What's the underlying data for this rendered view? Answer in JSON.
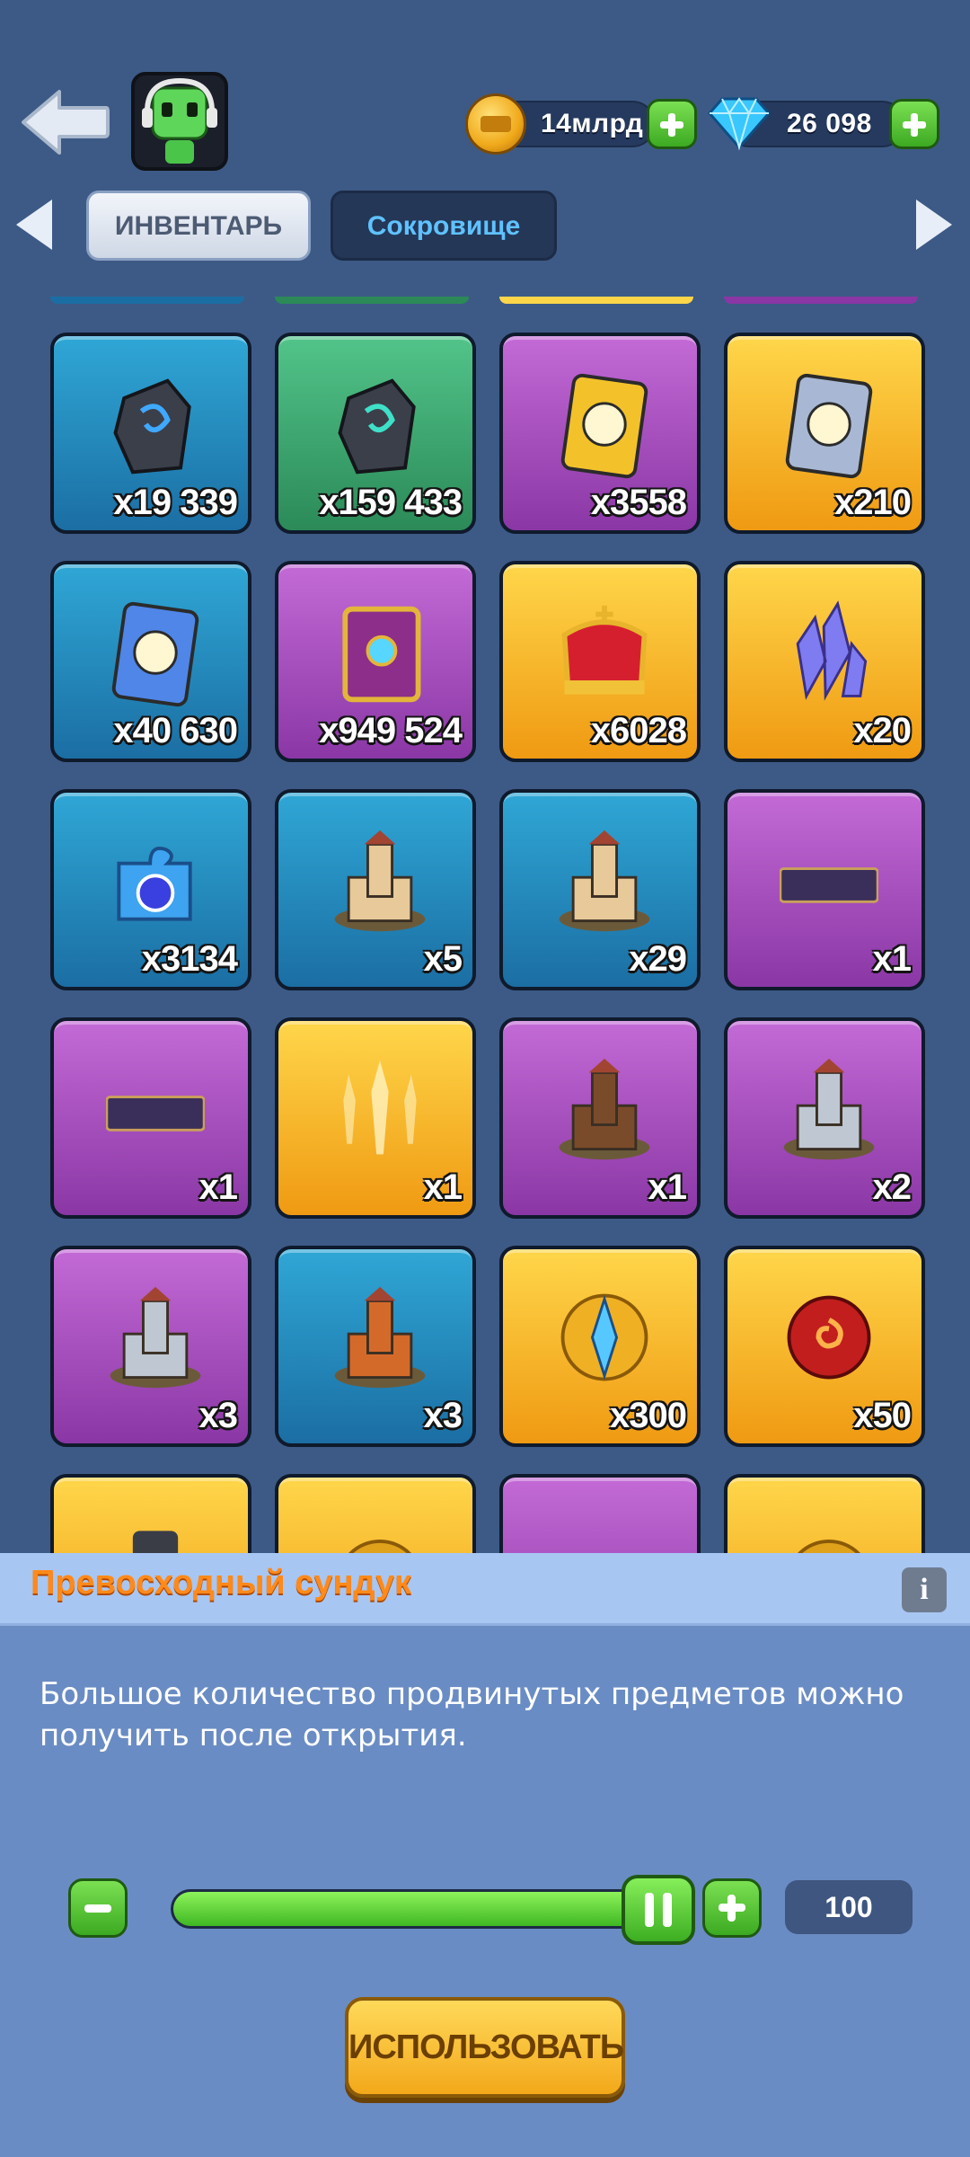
{
  "header": {
    "coins": "14млрд",
    "gems": "26 098"
  },
  "tabs": [
    {
      "label": "ИНВЕНТАРЬ",
      "active": true
    },
    {
      "label": "Сокровище",
      "active": false
    }
  ],
  "colors": {
    "blue": "#2fa7d6",
    "green": "#52c48a",
    "purple": "#c36ad6",
    "gold": "#ffd64a"
  },
  "items": [
    {
      "icon": "dark-rune-stone-blue-icon",
      "qty": "x19 339",
      "rarity": "blue"
    },
    {
      "icon": "dark-rune-stone-green-icon",
      "qty": "x159 433",
      "rarity": "green"
    },
    {
      "icon": "hero-card-gold-icon",
      "qty": "x3558",
      "rarity": "purple"
    },
    {
      "icon": "hero-card-silver-icon",
      "qty": "x210",
      "rarity": "gold"
    },
    {
      "icon": "helmet-card-blue-icon",
      "qty": "x40 630",
      "rarity": "blue"
    },
    {
      "icon": "spell-book-icon",
      "qty": "x949 524",
      "rarity": "purple"
    },
    {
      "icon": "royal-crown-icon",
      "qty": "x6028",
      "rarity": "gold"
    },
    {
      "icon": "purple-crystal-icon",
      "qty": "x20",
      "rarity": "gold"
    },
    {
      "icon": "potion-puzzle-piece-icon",
      "qty": "x3134",
      "rarity": "blue"
    },
    {
      "icon": "sand-castle-icon",
      "qty": "x5",
      "rarity": "blue"
    },
    {
      "icon": "sand-castle-icon",
      "qty": "x29",
      "rarity": "blue"
    },
    {
      "icon": "theater-frame-icon",
      "qty": "x1",
      "rarity": "purple"
    },
    {
      "icon": "party-frame-icon",
      "qty": "x1",
      "rarity": "purple"
    },
    {
      "icon": "golden-swords-icon",
      "qty": "x1",
      "rarity": "gold"
    },
    {
      "icon": "cake-castle-icon",
      "qty": "x1",
      "rarity": "purple"
    },
    {
      "icon": "stone-fortress-icon",
      "qty": "x2",
      "rarity": "purple"
    },
    {
      "icon": "stone-fortress-icon",
      "qty": "x3",
      "rarity": "purple"
    },
    {
      "icon": "dragon-lava-castle-icon",
      "qty": "x3",
      "rarity": "blue"
    },
    {
      "icon": "compass-gem-icon",
      "qty": "x300",
      "rarity": "gold"
    },
    {
      "icon": "dragon-orb-icon",
      "qty": "x50",
      "rarity": "gold"
    },
    {
      "icon": "knight-statue-icon",
      "qty": "",
      "rarity": "gold"
    },
    {
      "icon": "gold-coin-token-icon",
      "qty": "",
      "rarity": "gold"
    },
    {
      "icon": "crown-emblem-icon",
      "qty": "",
      "rarity": "purple"
    },
    {
      "icon": "gold-coin-token-icon",
      "qty": "",
      "rarity": "gold"
    }
  ],
  "detail": {
    "title": "Превосходный сундук",
    "info_label": "i",
    "description": "Большое количество продвинутых предметов можно получить после открытия.",
    "quantity": "100",
    "slider_fraction": 1.0,
    "use_label": "ИСПОЛЬЗОВАТЬ"
  }
}
